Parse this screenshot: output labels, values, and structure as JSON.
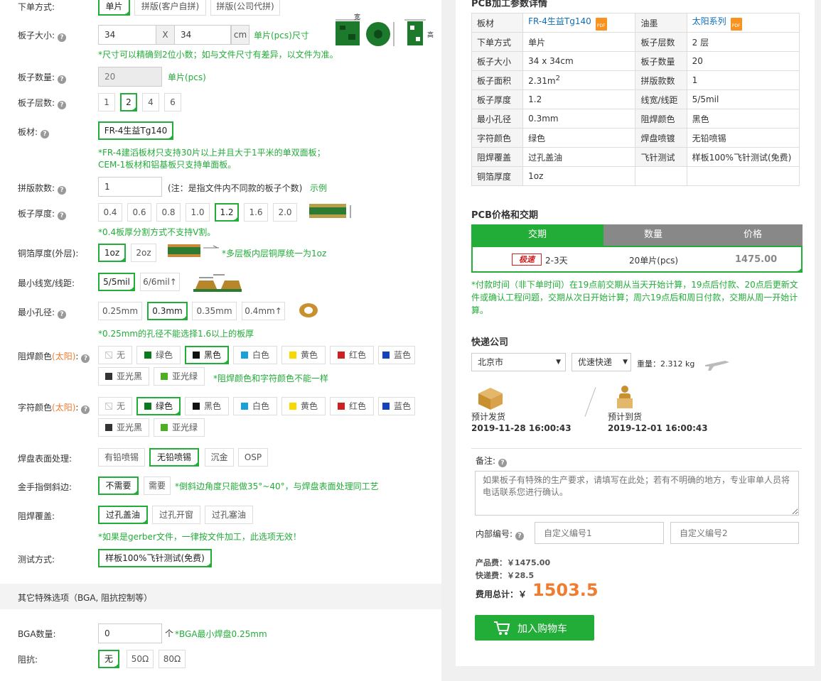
{
  "left": {
    "order": {
      "label": "下单方式:",
      "options": [
        "单片",
        "拼版(客户自拼)",
        "拼版(公司代拼)"
      ]
    },
    "size": {
      "label": "板子大小:",
      "width": "34",
      "x": "X",
      "height": "34",
      "unit": "cm",
      "suffix": "单片(pcs)尺寸",
      "note": "*尺寸可以精确到2位小数；如与文件尺寸有差异，以文件为准。",
      "img_w": "宽",
      "img_h": "高"
    },
    "qty": {
      "label": "板子数量:",
      "value": "20",
      "unit": "单片(pcs)"
    },
    "layers": {
      "label": "板子层数:",
      "options": [
        "1",
        "2",
        "4",
        "6"
      ]
    },
    "material": {
      "label": "板材:",
      "value": "FR-4生益Tg140",
      "note1": "*FR-4建滔板材只支持30片以上并且大于1平米的单双面板；",
      "note2": "CEM-1板材和铝基板只支持单面板。"
    },
    "panel": {
      "label": "拼版款数:",
      "value": "1",
      "hint": "(注：是指文件内不同款的板子个数)",
      "example": "示例"
    },
    "thickness": {
      "label": "板子厚度:",
      "options": [
        "0.4",
        "0.6",
        "0.8",
        "1.0",
        "1.2",
        "1.6",
        "2.0"
      ],
      "note": "*0.4板厚分割方式不支持V割。"
    },
    "copper": {
      "label": "铜箔厚度(外层):",
      "options": [
        "1oz",
        "2oz"
      ],
      "note": "*多层板内层铜厚统一为1oz"
    },
    "trace": {
      "label": "最小线宽/线距:",
      "options": [
        "5/5mil",
        "6/6mil↑"
      ]
    },
    "hole": {
      "label": "最小孔径:",
      "options": [
        "0.25mm",
        "0.3mm",
        "0.35mm",
        "0.4mm↑"
      ],
      "note": "*0.25mm的孔径不能选择1.6以上的板厚"
    },
    "mask": {
      "label": "阻焊颜色",
      "brand": "(太阳)",
      "colon": ":",
      "options": [
        "无",
        "绿色",
        "黑色",
        "白色",
        "黄色",
        "红色",
        "蓝色",
        "亚光黑",
        "亚光绿"
      ],
      "note": "*阻焊颜色和字符颜色不能一样"
    },
    "silk": {
      "label": "字符颜色",
      "brand": "(太阳)",
      "colon": ":",
      "options": [
        "无",
        "绿色",
        "黑色",
        "白色",
        "黄色",
        "红色",
        "蓝色",
        "亚光黑",
        "亚光绿"
      ]
    },
    "surface": {
      "label": "焊盘表面处理:",
      "options": [
        "有铅喷锡",
        "无铅喷锡",
        "沉金",
        "OSP"
      ]
    },
    "gold": {
      "label": "金手指倒斜边:",
      "options": [
        "不需要",
        "需要"
      ],
      "note": "*倒斜边角度只能做35°~40°，与焊盘表面处理同工艺"
    },
    "cover": {
      "label": "阻焊覆盖:",
      "options": [
        "过孔盖油",
        "过孔开窗",
        "过孔塞油"
      ],
      "note": "*如果是gerber文件，一律按文件加工，此选项无效！"
    },
    "test": {
      "label": "测试方式:",
      "options": [
        "样板100%飞针测试(免费)"
      ]
    },
    "special": {
      "title": "其它特殊选项（BGA, 阻抗控制等）"
    },
    "bga": {
      "label": "BGA数量:",
      "value": "0",
      "unit": "个",
      "note": "*BGA最小焊盘0.25mm"
    },
    "imp": {
      "label": "阻抗:",
      "options": [
        "无",
        "50Ω",
        "80Ω"
      ]
    }
  },
  "colors": {
    "green": "#22ac38",
    "orange": "#f07c30",
    "swatch": {
      "无": "#ffffff",
      "绿色": "#0b7a1e",
      "黑色": "#111111",
      "白色": "#1aa0d8",
      "黄色": "#f7d800",
      "红色": "#d01f1f",
      "蓝色": "#1442b8",
      "亚光黑": "#333333",
      "亚光绿": "#4caf22"
    }
  },
  "right": {
    "detail_title": "PCB加工参数详情",
    "detail": [
      [
        "板材",
        "FR-4生益Tg140",
        "油墨",
        "太阳系列"
      ],
      [
        "下单方式",
        "单片",
        "板子层数",
        "2 层"
      ],
      [
        "板子大小",
        "34 x 34cm",
        "板子数量",
        "20"
      ],
      [
        "板子面积",
        "2.31m",
        "拼版款数",
        "1"
      ],
      [
        "板子厚度",
        "1.2",
        "线宽/线距",
        "5/5mil"
      ],
      [
        "最小孔径",
        "0.3mm",
        "阻焊颜色",
        "黑色"
      ],
      [
        "字符颜色",
        "绿色",
        "焊盘喷镀",
        "无铅喷锡"
      ],
      [
        "阻焊覆盖",
        "过孔盖油",
        "飞针测试",
        "样板100%飞针测试(免费)"
      ],
      [
        "铜箔厚度",
        "1oz",
        "",
        ""
      ]
    ],
    "area_sup": "2",
    "pdf": "PDF",
    "price_title": "PCB价格和交期",
    "price_tabs": [
      "交期",
      "数量",
      "价格"
    ],
    "price_row": {
      "badge": "极速",
      "days": "2-3天",
      "qty": "20单片(pcs)",
      "price": "1475.00"
    },
    "price_note": "*付款时间（非下单时间）在19点前交期从当天开始计算，19点后付款、20点后更新文件或确认工程问题，交期从次日开始计算；周六19点后和周日付款，交期从周一开始计算。",
    "ship_title": "快递公司",
    "city": "北京市",
    "courier": "优速快递",
    "weight": "重量：2.312 kg",
    "ship_label": "预计发货",
    "ship_date": "2019-11-28 16:00:43",
    "arrive_label": "预计到货",
    "arrive_date": "2019-12-01 16:00:43",
    "remark_label": "备注:",
    "remark_placeholder": "如果板子有特殊的生产要求，请填写在此处；若有不明确的地方，专业审单人员将电话联系您进行确认。",
    "internal_label": "内部编号:",
    "internal_ph1": "自定义编号1",
    "internal_ph2": "自定义编号2",
    "product_fee": "产品费：￥1475.00",
    "ship_fee": "快递费：￥28.5",
    "total_label": "费用总计：￥",
    "total": "1503.5",
    "cart": "加入购物车"
  }
}
